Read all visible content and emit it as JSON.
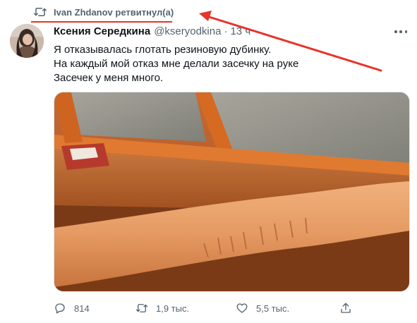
{
  "retweet": {
    "icon": "retweet-icon",
    "text": "Ivan Zhdanov ретвитнул(а)"
  },
  "annotation": {
    "color": "#e8322a"
  },
  "tweet": {
    "display_name": "Ксения Середкина",
    "handle": "@kseryodkina",
    "separator": "·",
    "time": "13 ч",
    "text_lines": [
      "Я отказывалась глотать резиновую дубинку.",
      "На каждый мой отказ мне делали засечку на руке",
      "Засечек у меня много."
    ]
  },
  "actions": {
    "reply": {
      "icon": "reply-icon",
      "count": "814"
    },
    "retweet": {
      "icon": "retweet-icon",
      "count": "1,9 тыс."
    },
    "like": {
      "icon": "heart-icon",
      "count": "5,5 тыс."
    },
    "share": {
      "icon": "share-icon"
    }
  },
  "colors": {
    "text_primary": "#0f1419",
    "text_secondary": "#536471",
    "annotation_red": "#e8322a"
  }
}
